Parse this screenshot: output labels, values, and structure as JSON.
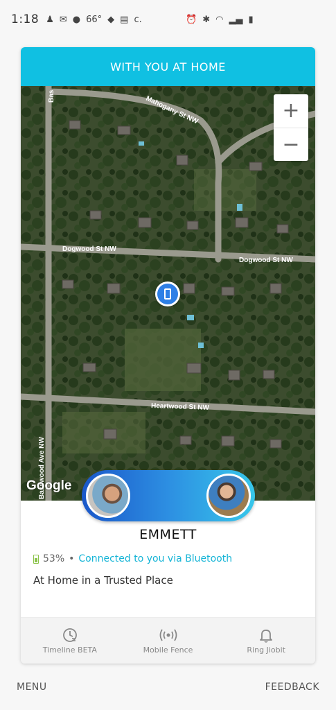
{
  "status_bar": {
    "time": "1:18",
    "temperature": "66°",
    "carrier_letter": "c."
  },
  "card": {
    "header_title": "WITH YOU AT HOME"
  },
  "map": {
    "streets": [
      "Mahogany St NW",
      "Dogwood St NW",
      "Dogwood St NW",
      "Heartwood St NW",
      "Basswood Ave NW",
      "Bas"
    ],
    "zoom_in": "+",
    "zoom_out": "−",
    "attribution": "Google"
  },
  "person": {
    "name": "EMMETT",
    "battery": "53%",
    "separator": "•",
    "connection": "Connected to you via Bluetooth",
    "location": "At Home in a Trusted Place"
  },
  "bottom_nav": [
    {
      "label": "Timeline BETA",
      "icon": "timeline-clock-icon"
    },
    {
      "label": "Mobile Fence",
      "icon": "broadcast-icon"
    },
    {
      "label": "Ring Jiobit",
      "icon": "bell-icon"
    }
  ],
  "footer": {
    "menu": "MENU",
    "feedback": "FEEDBACK"
  },
  "colors": {
    "header": "#10c0e2",
    "connection_text": "#14b4d6",
    "battery": "#8bc34a",
    "pin": "#2d7fe6"
  }
}
